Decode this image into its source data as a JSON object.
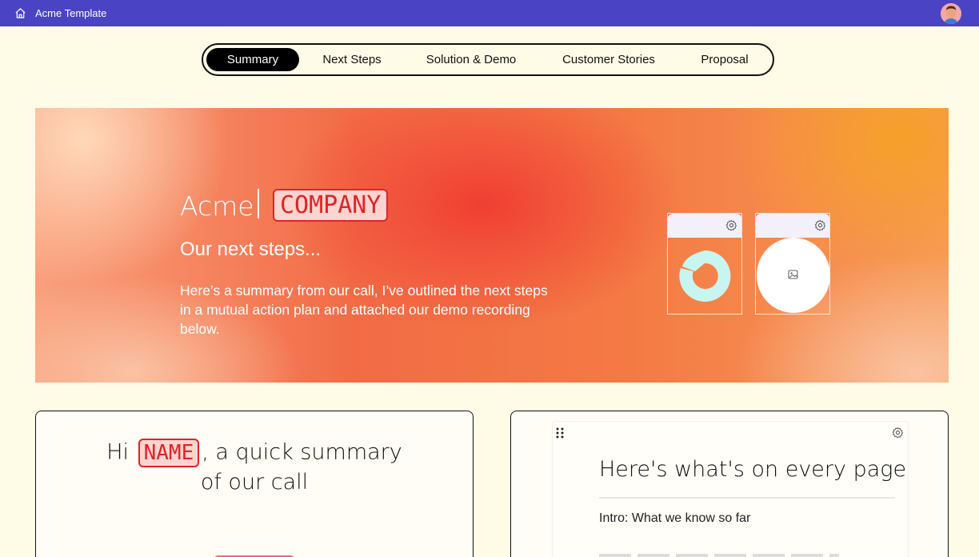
{
  "topbar": {
    "title": "Acme Template",
    "home_icon": "home-icon",
    "avatar_icon": "user-avatar"
  },
  "tabs": [
    {
      "label": "Summary",
      "active": true
    },
    {
      "label": "Next Steps",
      "active": false
    },
    {
      "label": "Solution & Demo",
      "active": false
    },
    {
      "label": "Customer Stories",
      "active": false
    },
    {
      "label": "Proposal",
      "active": false
    }
  ],
  "hero": {
    "brand": "Acme",
    "company_placeholder": "COMPANY",
    "subtitle": "Our next steps...",
    "body": "Here’s a summary from our call, I’ve outlined the next steps in a mutual action plan and attached our demo recording below.",
    "cards": [
      {
        "icon": "gear-icon",
        "content": "donut-logo"
      },
      {
        "icon": "gear-icon",
        "content": "image-placeholder-icon"
      }
    ]
  },
  "summary_panel": {
    "greeting_prefix": "Hi",
    "name_placeholder": "NAME",
    "greeting_suffix": ", a quick summary",
    "greeting_line2": "of our call"
  },
  "pages_panel": {
    "title": "Here's what's on every page",
    "items": [
      "Intro: What we know so far"
    ]
  },
  "colors": {
    "topbar": "#4a44c4",
    "background": "#fefbe6",
    "placeholder_red": "#e02424",
    "placeholder_bg": "#fdd4d0",
    "logo_mint": "#c8f5ef"
  }
}
